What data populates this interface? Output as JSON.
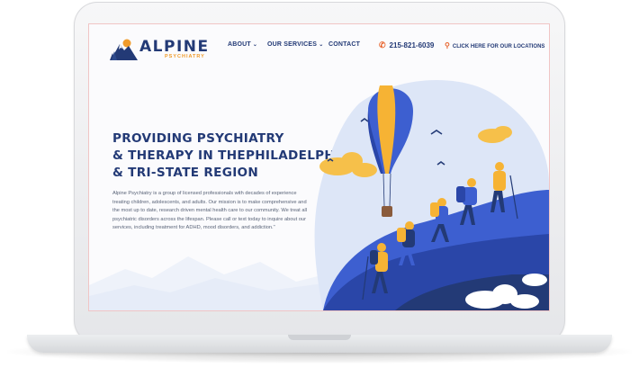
{
  "logo": {
    "name": "ALPINE",
    "tagline": "PSYCHIATRY"
  },
  "nav": {
    "about": "ABOUT",
    "services": "OUR SERVICES",
    "contact": "CONTACT",
    "phone": "215-821-6039",
    "locations": "CLICK HERE FOR OUR LOCATIONS"
  },
  "hero": {
    "title_lines": [
      "PROVIDING PSYCHIATRY",
      "& THERAPY IN THEPHILADELPHIA",
      "& TRI-STATE REGION"
    ],
    "body": "Alpine Psychiatry is a group of licensed professionals with decades of experience treating children, adolescents, and adults. Our mission is to make comprehensive and the most up to date, research driven mental health care to our community. We treat all psychiatric disorders across the lifespan. Please call or text today to inquire about our services, including treatment for ADHD, mood disorders, and addiction.\""
  },
  "colors": {
    "navy": "#233a76",
    "orange": "#f09b2a",
    "accent": "#e8652e",
    "blue": "#3d5fd0"
  },
  "icons": [
    "phone-icon",
    "location-pin-icon",
    "chevron-down-icon",
    "mountain-logo-icon"
  ]
}
